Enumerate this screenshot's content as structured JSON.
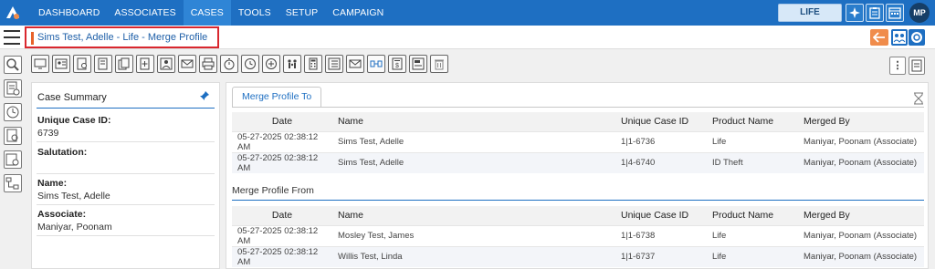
{
  "nav": {
    "items": [
      {
        "label": "DASHBOARD",
        "active": false
      },
      {
        "label": "ASSOCIATES",
        "active": false
      },
      {
        "label": "CASES",
        "active": true
      },
      {
        "label": "TOOLS",
        "active": false
      },
      {
        "label": "SETUP",
        "active": false
      },
      {
        "label": "CAMPAIGN",
        "active": false
      }
    ],
    "life_label": "LIFE",
    "avatar_initials": "MP"
  },
  "title": {
    "page_title": "Sims Test, Adelle - Life - Merge Profile"
  },
  "summary": {
    "title": "Case Summary",
    "fields": [
      {
        "label": "Unique Case ID:",
        "value": "6739"
      },
      {
        "label": "Salutation:",
        "value": ""
      },
      {
        "label": "Name:",
        "value": "Sims Test, Adelle"
      },
      {
        "label": "Associate:",
        "value": "Maniyar, Poonam"
      }
    ]
  },
  "main": {
    "tab_label": "Merge Profile To",
    "columns": [
      "Date",
      "Name",
      "Unique Case ID",
      "Product Name",
      "Merged By"
    ],
    "merge_to_rows": [
      [
        "05-27-2025 02:38:12 AM",
        "Sims Test, Adelle",
        "1|1-6736",
        "Life",
        "Maniyar, Poonam (Associate)"
      ],
      [
        "05-27-2025 02:38:12 AM",
        "Sims Test, Adelle",
        "1|4-6740",
        "ID Theft",
        "Maniyar, Poonam (Associate)"
      ]
    ],
    "merge_from_label": "Merge Profile From",
    "merge_from_rows": [
      [
        "05-27-2025 02:38:12 AM",
        "Mosley Test, James",
        "1|1-6738",
        "Life",
        "Maniyar, Poonam (Associate)"
      ],
      [
        "05-27-2025 02:38:12 AM",
        "Willis Test, Linda",
        "1|1-6737",
        "Life",
        "Maniyar, Poonam (Associate)"
      ]
    ]
  },
  "colors": {
    "nav_bg": "#1e6fc2",
    "title_text": "#1e5fa8",
    "highlight_border": "#d9272e",
    "back_button": "#f08c4b"
  }
}
